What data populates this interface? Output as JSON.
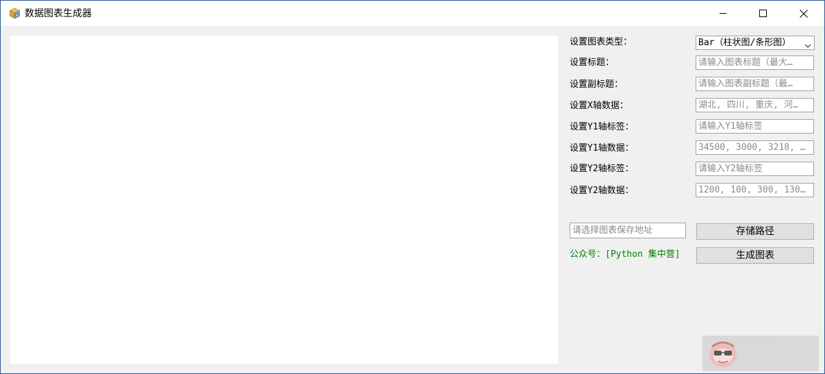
{
  "window": {
    "title": "数据图表生成器",
    "app_icon": "gear-cube-icon",
    "controls": [
      "minimize-icon",
      "maximize-icon",
      "close-icon"
    ]
  },
  "form": {
    "chart_type": {
      "label": "设置图表类型：",
      "selected": "Bar（柱状图/条形图）"
    },
    "title": {
      "label": "设置标题：",
      "placeholder": "请输入图表标题（最大…"
    },
    "subtitle": {
      "label": "设置副标题：",
      "placeholder": "请输入图表副标题（最…"
    },
    "x_data": {
      "label": "设置X轴数据：",
      "placeholder": "湖北, 四川, 重庆, 河…"
    },
    "y1_label": {
      "label": "设置Y1轴标签：",
      "placeholder": "请输入Y1轴标签"
    },
    "y1_data": {
      "label": "设置Y1轴数据：",
      "placeholder": "34500, 3000, 3218, …"
    },
    "y2_label": {
      "label": "设置Y2轴标签：",
      "placeholder": "请输入Y2轴标签"
    },
    "y2_data": {
      "label": "设置Y2轴数据：",
      "placeholder": "1200, 100, 300, 130…"
    }
  },
  "save": {
    "path_placeholder": "请选择图表保存地址",
    "path_button": "存储路径",
    "generate_button": "生成图表"
  },
  "credit": "公众号：[Python 集中营]",
  "colors": {
    "credit": "#008000",
    "window_border": "#2b5797",
    "panel_bg": "#f0f0f0"
  }
}
